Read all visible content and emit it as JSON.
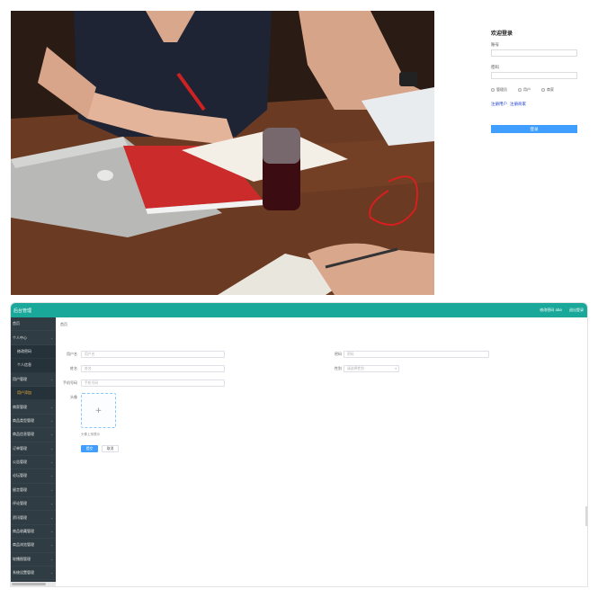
{
  "login": {
    "title": "欢迎登录",
    "username_label": "账号",
    "username_placeholder": "",
    "password_label": "密码",
    "password_placeholder": "",
    "roles": [
      "管理员",
      "用户",
      "商家"
    ],
    "link_register": "注册用户",
    "link_forgot": "注册商家",
    "submit_label": "登录"
  },
  "admin": {
    "brand": "后台管理",
    "header_links": [
      "修改密码 abo",
      "退出登录"
    ],
    "sidebar": [
      {
        "label": "首页",
        "sub": false,
        "chev": false,
        "active": false
      },
      {
        "label": "个人中心",
        "sub": false,
        "chev": true,
        "active": false
      },
      {
        "label": "修改密码",
        "sub": true,
        "chev": false,
        "active": false
      },
      {
        "label": "个人信息",
        "sub": true,
        "chev": false,
        "active": false
      },
      {
        "label": "用户管理",
        "sub": false,
        "chev": true,
        "active": false
      },
      {
        "label": "用户添加",
        "sub": true,
        "chev": false,
        "active": true
      },
      {
        "label": "商家管理",
        "sub": false,
        "chev": true,
        "active": false
      },
      {
        "label": "商品类型管理",
        "sub": false,
        "chev": true,
        "active": false
      },
      {
        "label": "商品信息管理",
        "sub": false,
        "chev": true,
        "active": false
      },
      {
        "label": "订单管理",
        "sub": false,
        "chev": true,
        "active": false
      },
      {
        "label": "公告管理",
        "sub": false,
        "chev": true,
        "active": false
      },
      {
        "label": "论坛管理",
        "sub": false,
        "chev": true,
        "active": false
      },
      {
        "label": "留言管理",
        "sub": false,
        "chev": true,
        "active": false
      },
      {
        "label": "评论管理",
        "sub": false,
        "chev": true,
        "active": false
      },
      {
        "label": "资讯管理",
        "sub": false,
        "chev": true,
        "active": false
      },
      {
        "label": "商品收藏管理",
        "sub": false,
        "chev": true,
        "active": false
      },
      {
        "label": "商品浏览管理",
        "sub": false,
        "chev": true,
        "active": false
      },
      {
        "label": "轮播图管理",
        "sub": false,
        "chev": true,
        "active": false
      },
      {
        "label": "系统设置管理",
        "sub": false,
        "chev": true,
        "active": false
      },
      {
        "label": "系统管理",
        "sub": false,
        "chev": true,
        "active": false
      }
    ],
    "breadcrumb": "首页",
    "form": {
      "username_label": "用户名",
      "username_placeholder": "用户名",
      "password_label": "密码",
      "password_placeholder": "密码",
      "name_label": "姓名",
      "name_placeholder": "姓名",
      "gender_label": "性别",
      "gender_placeholder": "请选择性别",
      "phone_label": "手机号码",
      "phone_placeholder": "手机号码",
      "avatar_label": "头像",
      "upload_plus": "+",
      "upload_hint": "头像上传提示",
      "submit_label": "提交",
      "reset_label": "取消"
    }
  }
}
